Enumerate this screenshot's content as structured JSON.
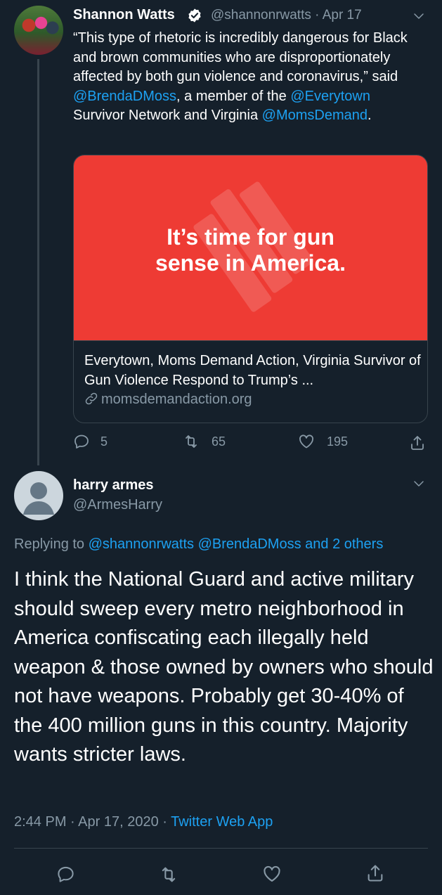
{
  "tweet1": {
    "display_name": "Shannon Watts",
    "handle": "@shannonrwatts",
    "date": "· Apr 17",
    "text_parts": {
      "t1": "“This type of rhetoric is incredibly dangerous for Black and brown communities who are disproportionately affected by both gun violence and coronavirus,” said ",
      "m1": "@BrendaDMoss",
      "t2": ", a member of the ",
      "m2": "@Everytown",
      "t3": " Survivor Network and Virginia ",
      "m3": "@MomsDemand",
      "t4": "."
    },
    "card": {
      "image_headline_line1": "It’s time for gun",
      "image_headline_line2": "sense in America.",
      "title": "Everytown, Moms Demand Action, Virginia Survivor of Gun Violence Respond to Trump’s ...",
      "domain": "momsdemandaction.org"
    },
    "stats": {
      "replies": "5",
      "retweets": "65",
      "likes": "195"
    }
  },
  "tweet2": {
    "display_name": "harry armes",
    "handle": "@ArmesHarry",
    "replying_label": "Replying to",
    "replying_to": "@shannonrwatts @BrendaDMoss and 2 others",
    "text": "I think the National Guard and active military should sweep every metro neighborhood in America confiscating each illegally held weapon & those owned by owners who should not have weapons. Probably get 30-40% of the 400 million guns in this country. Majority wants stricter laws.",
    "time": "2:44 PM",
    "date": "· Apr 17, 2020 ·",
    "source": "Twitter Web App"
  },
  "icons": {
    "verified": "verified-badge-icon",
    "chevron": "chevron-down-icon",
    "reply": "reply-icon",
    "retweet": "retweet-icon",
    "like": "heart-icon",
    "share": "share-icon",
    "link": "link-icon"
  },
  "colors": {
    "background": "#15202b",
    "accent": "#1da1f2",
    "muted": "#8899a6",
    "border": "#38444d",
    "card_red": "#ee3b34"
  }
}
